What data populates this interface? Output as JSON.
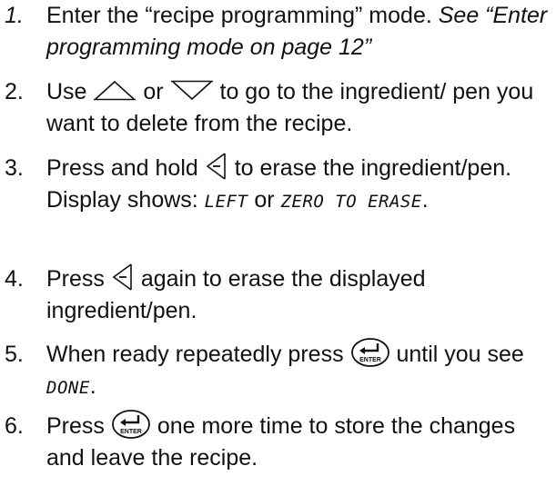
{
  "steps": [
    {
      "number": "1.",
      "text": "Enter the “recipe programming” mode. ",
      "see": "See “Enter programming mode on page 12”"
    },
    {
      "number": "2.",
      "use": "Use",
      "or": "or",
      "text": "to go to the ingredient/ pen you want to delete from the recipe."
    },
    {
      "number": "3.",
      "press_and_hold": "Press and hold",
      "text": "to erase the ingredient/pen.  Display shows: ",
      "display_left": "LEFT",
      "or": " or ",
      "display_zero": "ZERO TO ERASE",
      "end": "."
    },
    {
      "number": "4.",
      "press": "Press",
      "text": "again to erase the displayed ingredient/pen."
    },
    {
      "number": "5.",
      "text": "When ready repeatedly press",
      "until": "until you see ",
      "display_done": "DONE",
      "end": "."
    },
    {
      "number": "6.",
      "press": "Press",
      "text": "one more time to store the changes and leave the recipe."
    }
  ],
  "icons": {
    "up": "up-arrow-key-icon",
    "down": "down-arrow-key-icon",
    "left": "left-zero-key-icon",
    "enter": "enter-key-icon",
    "enter_label": "ENTER"
  }
}
